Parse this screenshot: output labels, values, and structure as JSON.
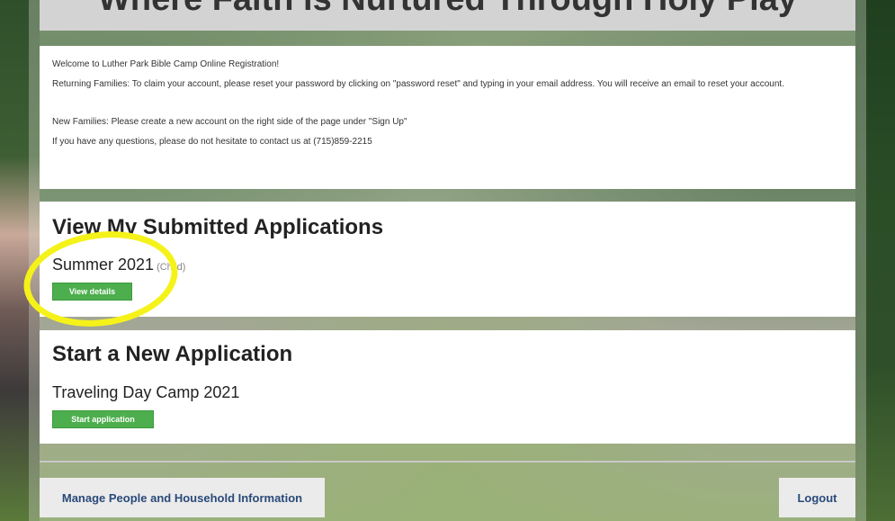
{
  "header": {
    "title": "Where Faith is Nurtured Through Holy Play"
  },
  "welcome": {
    "line1": "Welcome to Luther Park Bible Camp Online Registration!",
    "line2": "Returning Families: To claim your account, please reset your password by clicking on \"password reset\" and typing in your email address. You will receive an email to reset your account.",
    "line3": "New Families: Please create a new account on the right side of the page under \"Sign Up\"",
    "line4": "If you have any questions, please do not hesitate to contact us at (715)859-2215"
  },
  "submitted": {
    "title": "View My Submitted Applications",
    "app_name": "Summer 2021",
    "app_tag": "(Child)",
    "button_label": "View details"
  },
  "new_application": {
    "title": "Start a New Application",
    "app_name": "Traveling Day Camp 2021",
    "button_label": "Start application"
  },
  "footer": {
    "manage_label": "Manage People and Household Information",
    "logout_label": "Logout"
  },
  "colors": {
    "button_green": "#4cae4c",
    "link_blue": "#2a4a7a",
    "highlight_yellow": "#f5f21a"
  }
}
